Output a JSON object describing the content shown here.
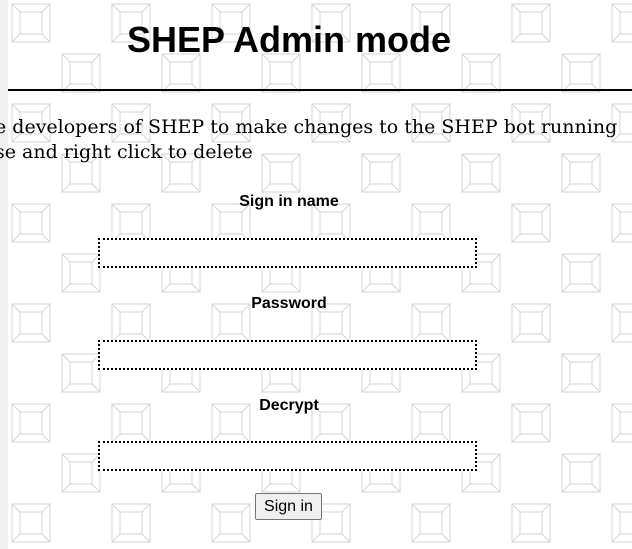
{
  "header": {
    "title": "SHEP Admin mode"
  },
  "description": {
    "line1": "e developers of SHEP to make changes to the SHEP bot running",
    "line2": "se and right click to delete"
  },
  "form": {
    "username": {
      "label": "Sign in name",
      "value": "",
      "placeholder": ""
    },
    "password": {
      "label": "Password",
      "value": "",
      "placeholder": ""
    },
    "decrypt": {
      "label": "Decrypt",
      "value": "",
      "placeholder": ""
    },
    "submit_label": "Sign in"
  },
  "colors": {
    "background": "#ffffff",
    "text": "#000000",
    "pattern_stroke": "#d4d4d4"
  }
}
